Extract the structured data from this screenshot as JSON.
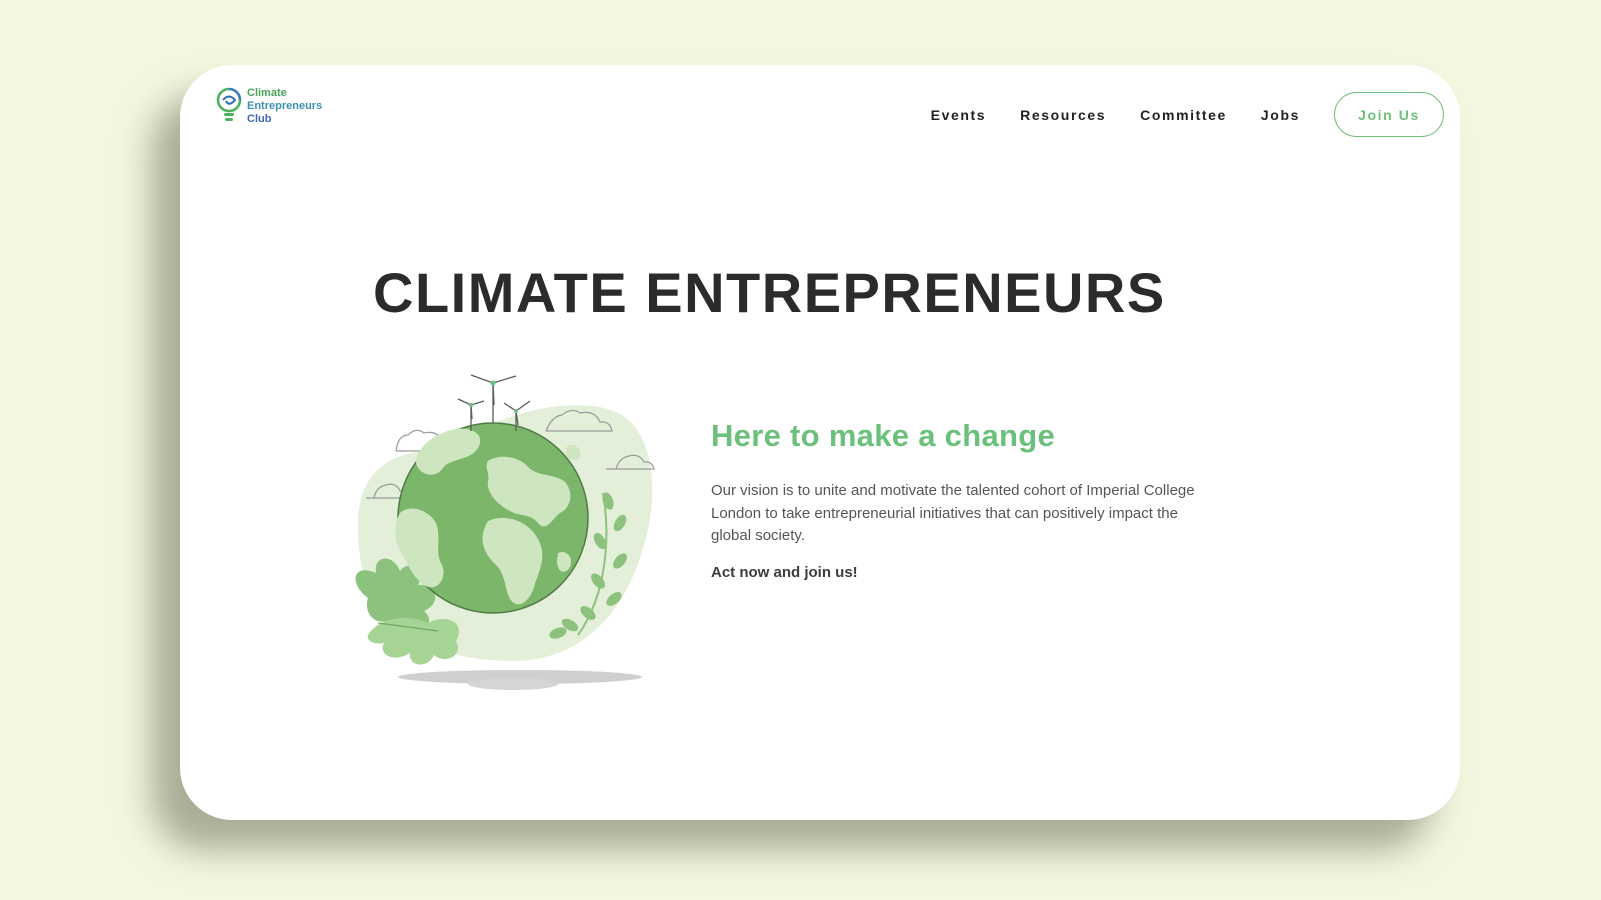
{
  "logo": {
    "line1": "Climate",
    "line2": "Entrepreneurs",
    "line3": "Club"
  },
  "nav": {
    "links": [
      "Events",
      "Resources",
      "Committee",
      "Jobs"
    ],
    "join_label": "Join Us"
  },
  "hero": {
    "title": "CLIMATE ENTREPRENEURS",
    "subtitle": "Here to make a change",
    "vision": "Our vision is to unite and motivate the talented cohort of Imperial College London to take entrepreneurial initiatives that can positively impact the global society.",
    "cta": "Act now and join us!"
  },
  "icons": {
    "logo": "lightbulb-swirl-icon",
    "illustration": "globe-wind-turbines-illustration"
  },
  "colors": {
    "background": "#f4f7df",
    "accent_green": "#6bc17c",
    "globe_green": "#7cb66a",
    "headline": "#2b2b2b"
  }
}
